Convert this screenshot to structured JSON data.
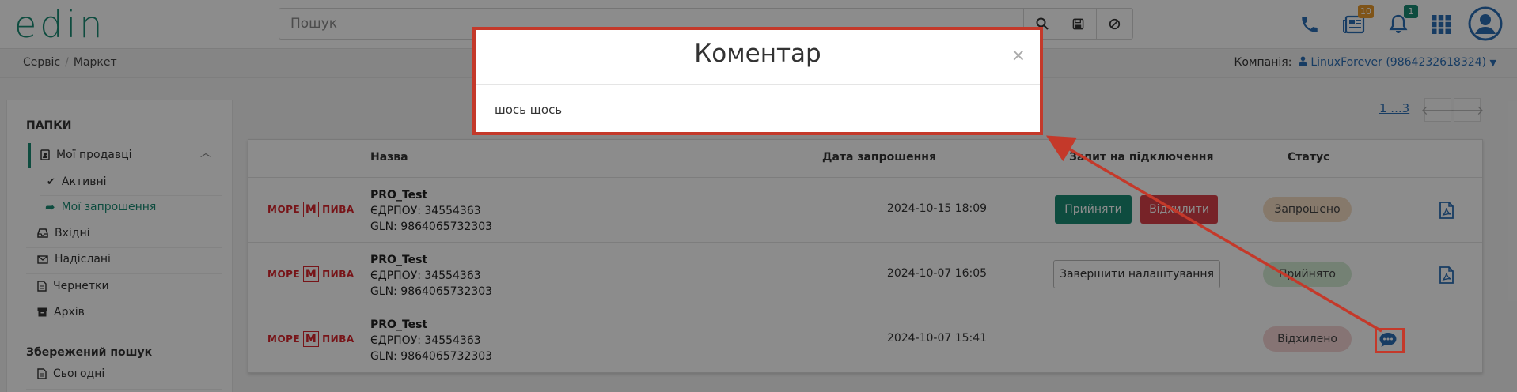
{
  "header": {
    "logo": "edin",
    "search_placeholder": "Пошук",
    "docs_badge": "10",
    "notif_badge": "1"
  },
  "breadcrumb": {
    "items": [
      "Сервіс",
      "Маркет"
    ],
    "company_label": "Компанія:",
    "company_value": "LinuxForever (9864232618324)"
  },
  "sidebar": {
    "folders_title": "ПАПКИ",
    "my_sellers": "Мої продавці",
    "active": "Активні",
    "my_invitations": "Мої запрошення",
    "inbox": "Вхідні",
    "sent": "Надіслані",
    "drafts": "Чернетки",
    "archive": "Архів",
    "saved_search_title": "Збережений пошук",
    "today": "Сьогодні"
  },
  "pager": {
    "label": "1 ...3"
  },
  "table": {
    "headers": {
      "name": "Назва",
      "date": "Дата запрошення",
      "request": "Запит на підключення",
      "status": "Статус"
    },
    "logo_left": "МОРЕ",
    "logo_mid": "М",
    "logo_right": "ПИВА",
    "rows": [
      {
        "name": "PRO_Test",
        "edrpou": "ЄДРПОУ: 34554363",
        "gln": "GLN: 9864065732303",
        "date": "2024-10-15 18:09",
        "accept": "Прийняти",
        "reject": "Відхилити",
        "status": "Запрошено"
      },
      {
        "name": "PRO_Test",
        "edrpou": "ЄДРПОУ: 34554363",
        "gln": "GLN: 9864065732303",
        "date": "2024-10-07 16:05",
        "finish": "Завершити налаштування",
        "status": "Прийнято"
      },
      {
        "name": "PRO_Test",
        "edrpou": "ЄДРПОУ: 34554363",
        "gln": "GLN: 9864065732303",
        "date": "2024-10-07 15:41",
        "status": "Відхилено"
      }
    ]
  },
  "modal": {
    "title": "Коментар",
    "close": "×",
    "body": "шось щось"
  },
  "colors": {
    "brand": "#1a8a73",
    "accept": "#1a8a73",
    "reject": "#d9414a",
    "highlight": "#c4392a",
    "link": "#2a6db5"
  }
}
